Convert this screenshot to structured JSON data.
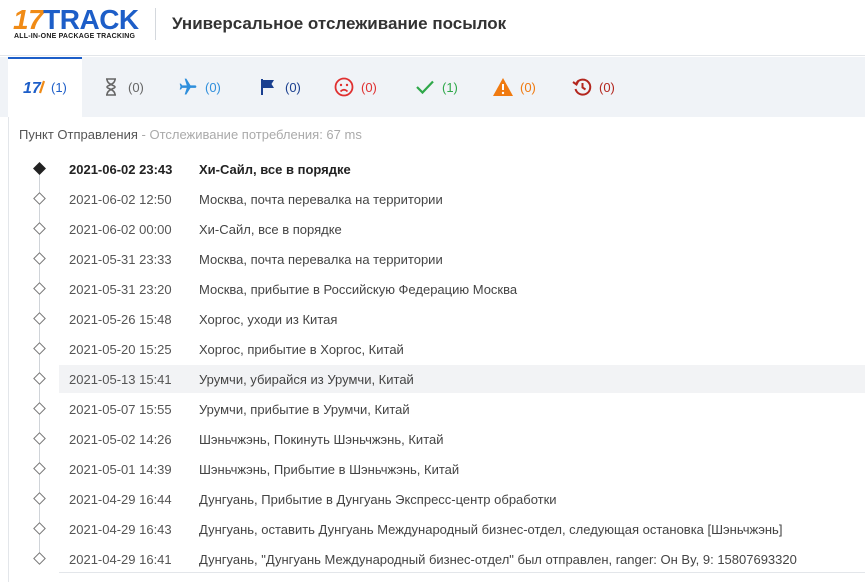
{
  "header": {
    "logo_num": "17",
    "logo_word": "TRACK",
    "logo_tagline": "ALL-IN-ONE PACKAGE TRACKING",
    "title": "Универсальное отслеживание посылок"
  },
  "tabs": [
    {
      "name": "all",
      "icon": "seventeen-logo-icon",
      "count": "(1)",
      "color": "#1d5ec8"
    },
    {
      "name": "not-found",
      "icon": "hourglass-icon",
      "count": "(0)",
      "color": "#666666"
    },
    {
      "name": "in-transit",
      "icon": "airplane-icon",
      "count": "(0)",
      "color": "#2f8fdc"
    },
    {
      "name": "pick-up",
      "icon": "flag-icon",
      "count": "(0)",
      "color": "#1a3f8f"
    },
    {
      "name": "undelivered",
      "icon": "sad-face-icon",
      "count": "(0)",
      "color": "#e03030"
    },
    {
      "name": "delivered",
      "icon": "checkmark-icon",
      "count": "(1)",
      "color": "#2fa84a"
    },
    {
      "name": "alert",
      "icon": "warning-icon",
      "count": "(0)",
      "color": "#f07a10"
    },
    {
      "name": "expired",
      "icon": "history-icon",
      "count": "(0)",
      "color": "#b3261e"
    }
  ],
  "origin": {
    "label": "Пункт Отправления",
    "meta": " - Отслеживание потребления: 67 ms"
  },
  "events": [
    {
      "date": "2021-06-02 23:43",
      "text": "Хи-Сайл, все в порядке"
    },
    {
      "date": "2021-06-02 12:50",
      "text": "Москва, почта перевалка на территории"
    },
    {
      "date": "2021-06-02 00:00",
      "text": "Хи-Сайл, все в порядке"
    },
    {
      "date": "2021-05-31 23:33",
      "text": "Москва, почта перевалка на территории"
    },
    {
      "date": "2021-05-31 23:20",
      "text": "Москва, прибытие в Российскую Федерацию Москва"
    },
    {
      "date": "2021-05-26 15:48",
      "text": "Хоргос, уходи из Китая"
    },
    {
      "date": "2021-05-20 15:25",
      "text": "Хоргос, прибытие в Хоргос, Китай"
    },
    {
      "date": "2021-05-13 15:41",
      "text": "Урумчи, убирайся из Урумчи, Китай"
    },
    {
      "date": "2021-05-07 15:55",
      "text": "Урумчи, прибытие в Урумчи, Китай"
    },
    {
      "date": "2021-05-02 14:26",
      "text": "Шэньчжэнь, Покинуть Шэньчжэнь, Китай"
    },
    {
      "date": "2021-05-01 14:39",
      "text": "Шэньчжэнь, Прибытие в Шэньчжэнь, Китай"
    },
    {
      "date": "2021-04-29 16:44",
      "text": "Дунгуань, Прибытие в Дунгуань Экспресс-центр обработки"
    },
    {
      "date": "2021-04-29 16:43",
      "text": "Дунгуань, оставить Дунгуань Международный бизнес-отдел, следующая остановка [Шэньчжэнь]"
    },
    {
      "date": "2021-04-29 16:41",
      "text": "Дунгуань, \"Дунгуань Международный бизнес-отдел\" был отправлен, ranger: Он By, 9: 15807693320"
    }
  ]
}
